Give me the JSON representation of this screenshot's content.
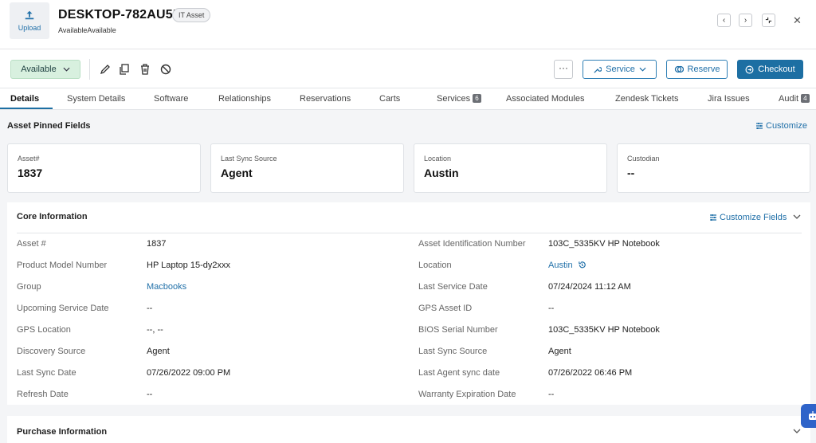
{
  "header": {
    "upload_label": "Upload",
    "asset_name": "DESKTOP-782AU5F",
    "asset_type": "IT Asset",
    "status_text": "AvailableAvailable"
  },
  "toolbar": {
    "status_label": "Available",
    "more_label": "···",
    "service_label": "Service",
    "reserve_label": "Reserve",
    "checkout_label": "Checkout"
  },
  "tabs": [
    {
      "label": "Details",
      "count": null
    },
    {
      "label": "System Details",
      "count": null
    },
    {
      "label": "Software",
      "count": null
    },
    {
      "label": "Relationships",
      "count": null
    },
    {
      "label": "Reservations",
      "count": null
    },
    {
      "label": "Carts",
      "count": null
    },
    {
      "label": "Services",
      "count": "6"
    },
    {
      "label": "Associated Modules",
      "count": null
    },
    {
      "label": "Zendesk Tickets",
      "count": null
    },
    {
      "label": "Jira Issues",
      "count": null
    },
    {
      "label": "Audit",
      "count": "4"
    }
  ],
  "pinned": {
    "title": "Asset Pinned Fields",
    "customize_label": "Customize",
    "cards": [
      {
        "label": "Asset#",
        "value": "1837"
      },
      {
        "label": "Last Sync Source",
        "value": "Agent"
      },
      {
        "label": "Location",
        "value": "Austin"
      },
      {
        "label": "Custodian",
        "value": "--"
      }
    ]
  },
  "core": {
    "title": "Core Information",
    "customize_label": "Customize Fields",
    "left_fields": [
      {
        "label": "Asset #",
        "value": "1837"
      },
      {
        "label": "Product Model Number",
        "value": "HP Laptop 15-dy2xxx"
      },
      {
        "label": "Group",
        "value": "Macbooks"
      },
      {
        "label": "Upcoming Service Date",
        "value": "--"
      },
      {
        "label": "GPS Location",
        "value": "--, --"
      },
      {
        "label": "Discovery Source",
        "value": "Agent"
      },
      {
        "label": "Last Sync Date",
        "value": "07/26/2022 09:00 PM"
      },
      {
        "label": "Refresh Date",
        "value": "--"
      }
    ],
    "right_fields": [
      {
        "label": "Asset Identification Number",
        "value": "103C_5335KV HP Notebook"
      },
      {
        "label": "Location",
        "value": "Austin"
      },
      {
        "label": "Last Service Date",
        "value": "07/24/2024 11:12 AM"
      },
      {
        "label": "GPS Asset ID",
        "value": "--"
      },
      {
        "label": "BIOS Serial Number",
        "value": "103C_5335KV HP Notebook"
      },
      {
        "label": "Last Sync Source",
        "value": "Agent"
      },
      {
        "label": "Last Agent sync date",
        "value": "07/26/2022 06:46 PM"
      },
      {
        "label": "Warranty Expiration Date",
        "value": "--"
      }
    ]
  },
  "purchase": {
    "title": "Purchase Information"
  },
  "colors": {
    "accent": "#1d6fa3",
    "link": "#1f6fa8",
    "available_bg": "#d8f0df"
  }
}
